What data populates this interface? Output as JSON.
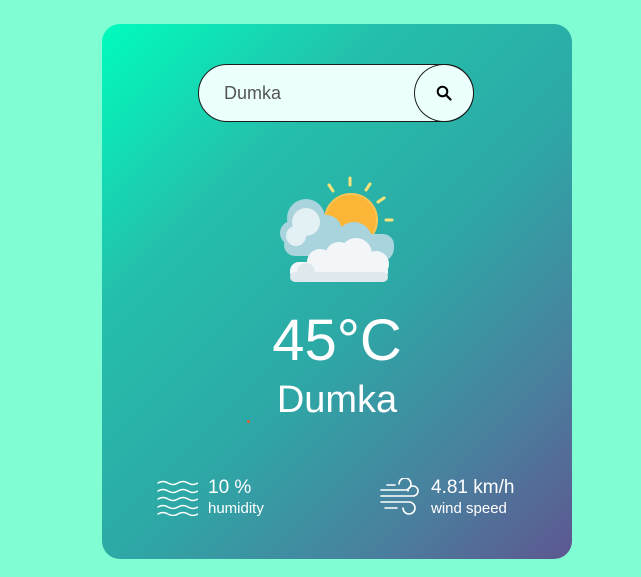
{
  "search": {
    "value": "Dumka",
    "button_icon": "search-icon"
  },
  "weather": {
    "icon": "partly-cloudy-sun-icon",
    "temperature": "45°C",
    "city": "Dumka"
  },
  "humidity": {
    "icon": "humidity-waves-icon",
    "value": "10 %",
    "label": "humidity"
  },
  "wind": {
    "icon": "wind-icon",
    "value": "4.81 km/h",
    "label": "wind speed"
  },
  "colors": {
    "page_background": "#80fdd3",
    "card_gradient_start": "#00fcbe",
    "card_gradient_end": "#5d5790",
    "text": "#ffffff",
    "search_background": "#ebfffc"
  }
}
